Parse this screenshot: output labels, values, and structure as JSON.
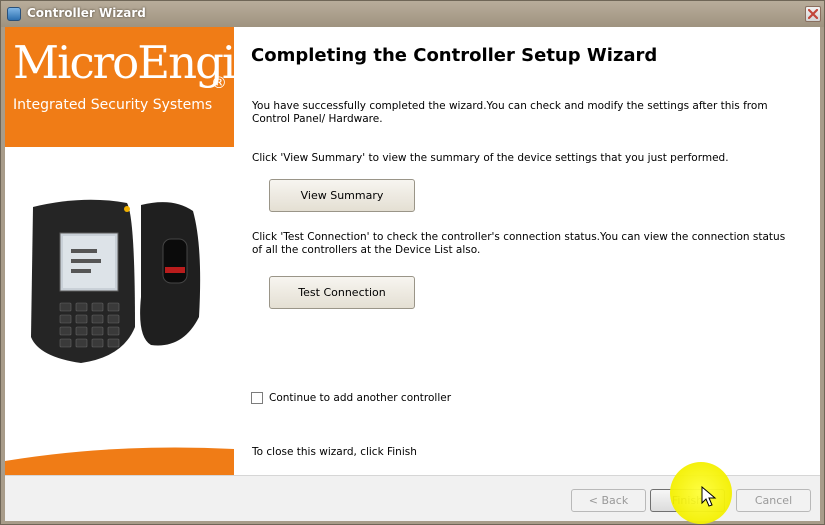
{
  "window": {
    "title": "Controller Wizard",
    "icons": {
      "app": "app-icon",
      "close": "close-icon"
    }
  },
  "brand": {
    "logo": "MicroEngine",
    "registered_mark": "®",
    "tagline": "Integrated Security Systems",
    "colors": {
      "orange": "#f07c16"
    }
  },
  "content": {
    "heading": "Completing the Controller Setup Wizard",
    "intro": "You have successfully completed the wizard.You can check and modify the settings after this from Control Panel/ Hardware.",
    "summary_hint": "Click 'View Summary' to view the summary of the device settings that you just performed.",
    "view_summary_label": "View Summary",
    "test_hint": "Click 'Test Connection' to check the controller's connection status.You can view the connection status of all the controllers at the Device List also.",
    "test_connection_label": "Test Connection",
    "continue_label": "Continue to add another controller",
    "continue_checked": false,
    "close_hint": "To close this wizard, click Finish"
  },
  "footer": {
    "back_label": "< Back",
    "finish_label": "Finish",
    "cancel_label": "Cancel"
  }
}
